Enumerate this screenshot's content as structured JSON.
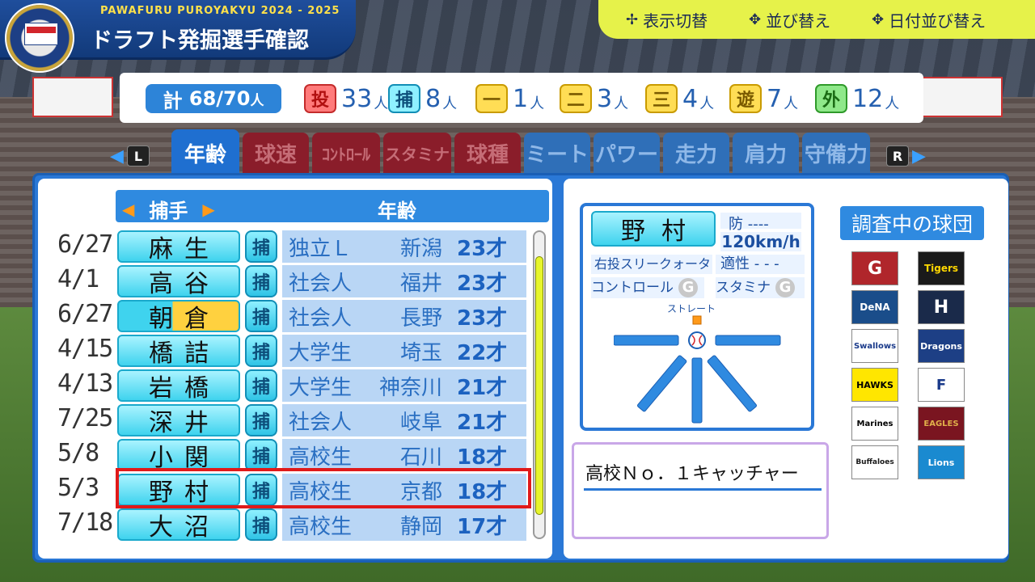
{
  "header": {
    "brand": "PAWAFURU PUROYAKYU 2024 - 2025",
    "title": "ドラフト発掘選手確認",
    "actions": [
      {
        "icon": "dpad-arrow-icon",
        "label": "表示切替"
      },
      {
        "icon": "buttons-icon",
        "label": "並び替え"
      },
      {
        "icon": "buttons-icon",
        "label": "日付並び替え"
      }
    ]
  },
  "totals": {
    "label": "計",
    "count": "68/70",
    "unit": "人",
    "positions": [
      {
        "badge": "投",
        "count": "33",
        "unit": "人",
        "color": "#e94a4a"
      },
      {
        "badge": "捕",
        "count": "8",
        "unit": "人",
        "color": "#3fc9e6"
      },
      {
        "badge": "一",
        "count": "1",
        "unit": "人",
        "color": "#ffcc22"
      },
      {
        "badge": "二",
        "count": "3",
        "unit": "人",
        "color": "#ffcc22"
      },
      {
        "badge": "三",
        "count": "4",
        "unit": "人",
        "color": "#ffcc22"
      },
      {
        "badge": "遊",
        "count": "7",
        "unit": "人",
        "color": "#ffcc22"
      },
      {
        "badge": "外",
        "count": "12",
        "unit": "人",
        "color": "#5fd05a"
      }
    ]
  },
  "tabs": {
    "left_key": "L",
    "right_key": "R",
    "items": [
      "年齢",
      "球速",
      "ｺﾝﾄﾛｰﾙ",
      "スタミナ",
      "球種",
      "ミート",
      "パワー",
      "走力",
      "肩力",
      "守備力"
    ],
    "active": "年齢"
  },
  "list": {
    "position_filter": "捕手",
    "column": "年齢",
    "rows": [
      {
        "date": "6/27",
        "name": "麻生",
        "pos": "捕",
        "aff": "独立Ｌ",
        "pref": "新潟",
        "age": "23才"
      },
      {
        "date": "4/1",
        "name": "高谷",
        "pos": "捕",
        "aff": "社会人",
        "pref": "福井",
        "age": "23才"
      },
      {
        "date": "6/27",
        "name": "朝倉",
        "pos": "捕",
        "aff": "社会人",
        "pref": "長野",
        "age": "23才"
      },
      {
        "date": "4/15",
        "name": "橋詰",
        "pos": "捕",
        "aff": "大学生",
        "pref": "埼玉",
        "age": "22才"
      },
      {
        "date": "4/13",
        "name": "岩橋",
        "pos": "捕",
        "aff": "大学生",
        "pref": "神奈川",
        "age": "21才"
      },
      {
        "date": "7/25",
        "name": "深井",
        "pos": "捕",
        "aff": "社会人",
        "pref": "岐阜",
        "age": "21才"
      },
      {
        "date": "5/8",
        "name": "小関",
        "pos": "捕",
        "aff": "高校生",
        "pref": "石川",
        "age": "18才"
      },
      {
        "date": "5/3",
        "name": "野村",
        "pos": "捕",
        "aff": "高校生",
        "pref": "京都",
        "age": "18才"
      },
      {
        "date": "7/18",
        "name": "大沼",
        "pos": "捕",
        "aff": "高校生",
        "pref": "静岡",
        "age": "17才"
      }
    ]
  },
  "detail": {
    "name": "野村",
    "era": "防 ----",
    "speed": "120km/h",
    "form": "右投スリークォーター",
    "aptitude": "適性 - - -",
    "control_label": "コントロール",
    "control_grade": "G",
    "stamina_label": "スタミナ",
    "stamina_grade": "G",
    "pitch_label": "ストレート",
    "note": "高校Ｎｏ．１キャッチャー"
  },
  "teams": {
    "title": "調査中の球団",
    "items": [
      {
        "name": "G",
        "bg": "#b0262b",
        "fg": "#ffffff"
      },
      {
        "name": "Tigers",
        "bg": "#1a1a1a",
        "fg": "#ffd700"
      },
      {
        "name": "DeNA",
        "bg": "#1a4d8a",
        "fg": "#ffffff"
      },
      {
        "name": "H",
        "bg": "#1a2a4a",
        "fg": "#ffffff"
      },
      {
        "name": "Swallows",
        "bg": "#ffffff",
        "fg": "#1a3a8a"
      },
      {
        "name": "Dragons",
        "bg": "#1d3f85",
        "fg": "#ffffff"
      },
      {
        "name": "HAWKS",
        "bg": "#ffe600",
        "fg": "#000000"
      },
      {
        "name": "F",
        "bg": "#ffffff",
        "fg": "#1a3a8a"
      },
      {
        "name": "Marines",
        "bg": "#ffffff",
        "fg": "#000000"
      },
      {
        "name": "EAGLES",
        "bg": "#7a1520",
        "fg": "#e0b04a"
      },
      {
        "name": "Buffaloes",
        "bg": "#ffffff",
        "fg": "#1a1a1a"
      },
      {
        "name": "Lions",
        "bg": "#1a8ad0",
        "fg": "#ffffff"
      }
    ]
  }
}
